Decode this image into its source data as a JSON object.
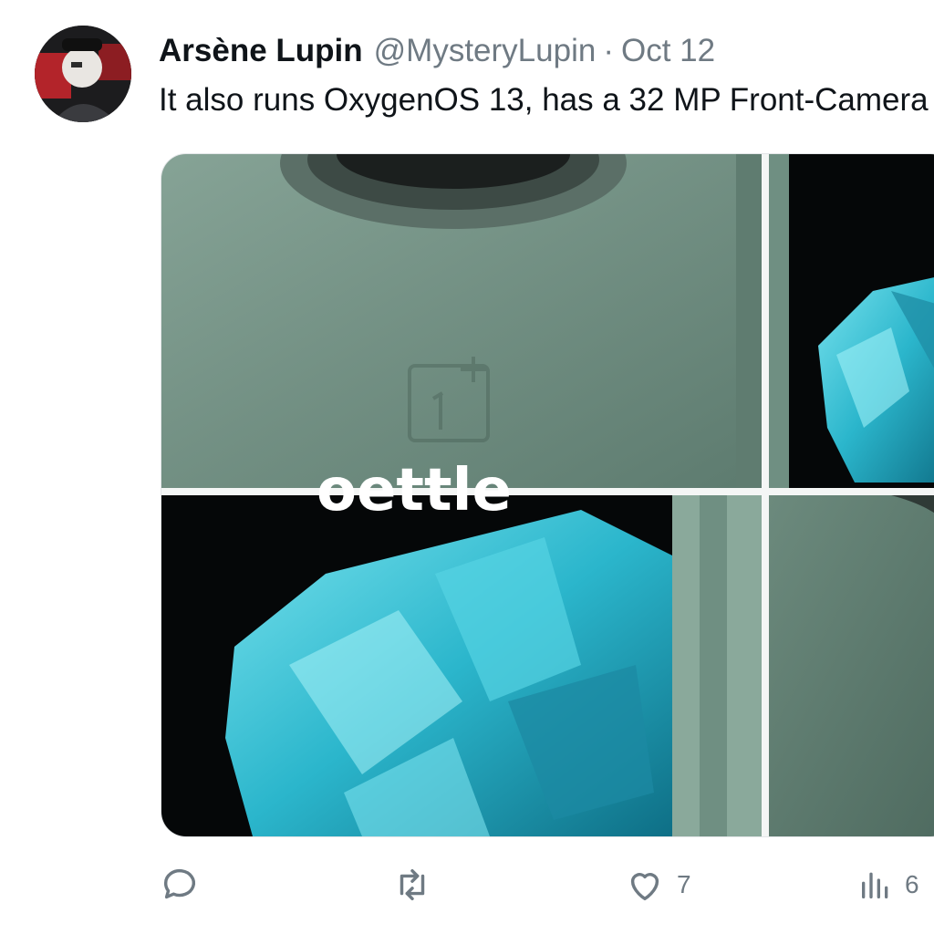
{
  "tweet": {
    "author_name": "Arsène Lupin",
    "handle": "@MysteryLupin",
    "separator": "·",
    "date": "Oct 12",
    "text": "It also runs OxygenOS 13, has a 32 MP Front-Camera"
  },
  "media": {
    "visible_partial_text": "oettle",
    "colors": {
      "phone_green": "#6f8f82",
      "crystal_cyan": "#39c2d6",
      "screen_black": "#050708"
    }
  },
  "actions": {
    "reply": {
      "icon": "reply-icon",
      "count": ""
    },
    "retweet": {
      "icon": "retweet-icon",
      "count": ""
    },
    "like": {
      "icon": "heart-icon",
      "count": "7"
    },
    "views": {
      "icon": "views-icon",
      "count": "6"
    }
  }
}
